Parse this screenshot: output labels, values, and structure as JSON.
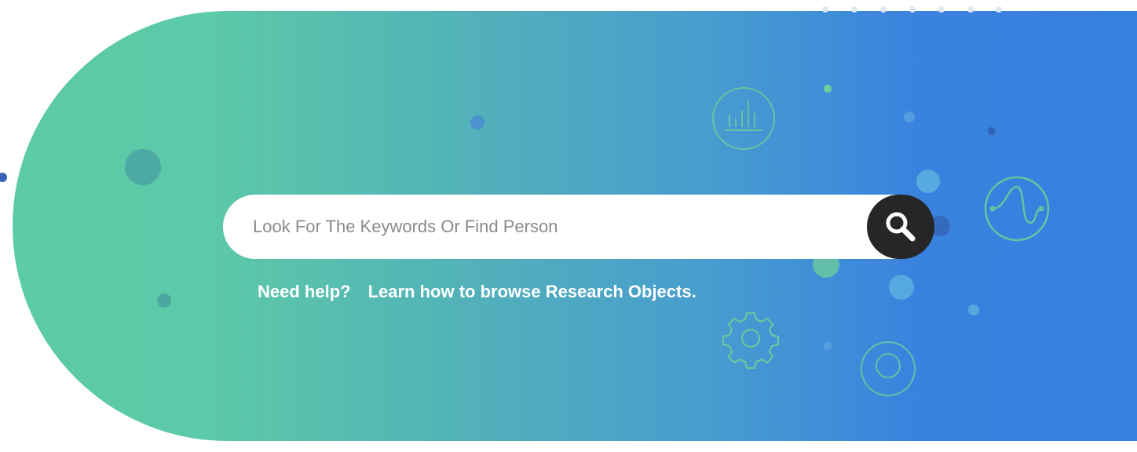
{
  "search": {
    "placeholder": "Look For The Keywords Or Find Person",
    "button_icon": "search-icon"
  },
  "help": {
    "prefix": "Need help?",
    "link_text": "Learn how to browse Research Objects."
  },
  "icons": {
    "chart": "bar-chart-icon",
    "wave": "wave-chart-icon",
    "gear": "gear-icon",
    "target": "target-icon"
  },
  "colors": {
    "gradient_start": "#5ccba6",
    "gradient_end": "#357fe0",
    "search_button": "#262626",
    "icon_stroke": "#6fcf97",
    "text": "#ffffff"
  }
}
